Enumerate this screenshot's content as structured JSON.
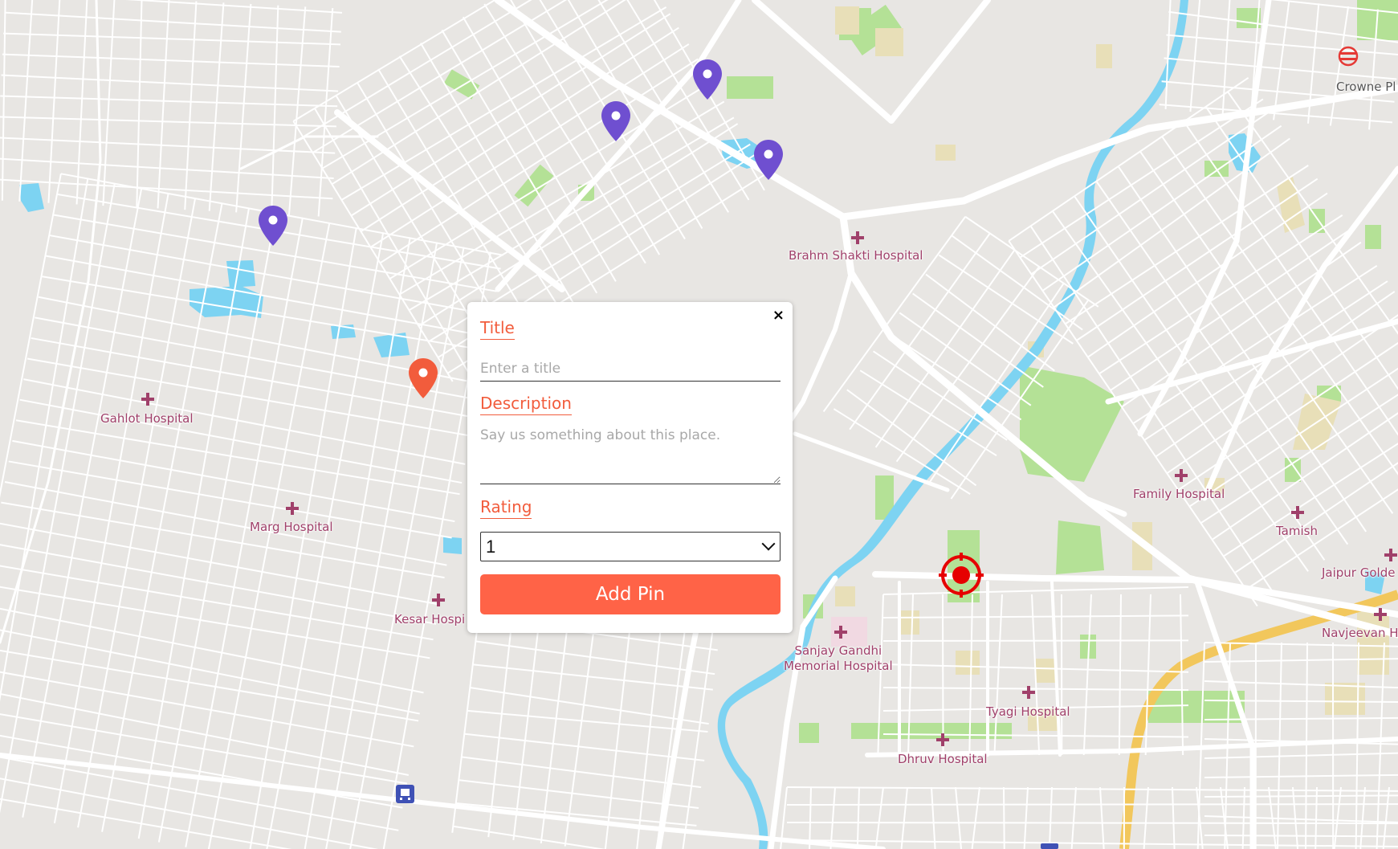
{
  "map": {
    "poi_labels": {
      "brahm_shakti": "Brahm Shakti Hospital",
      "gahlot": "Gahlot Hospital",
      "marg": "Marg Hospital",
      "kesar": "Kesar Hospi",
      "sanjay_gandhi_1": "Sanjay Gandhi",
      "sanjay_gandhi_2": "Memorial Hospital",
      "tyagi": "Tyagi Hospital",
      "dhruv": "Dhruv Hospital",
      "family": "Family Hospital",
      "tamish": "Tamish",
      "jaipur_golden": "Jaipur Golde",
      "navjeevan": "Navjeevan H",
      "crowne": "Crowne Pl"
    },
    "colors": {
      "land": "#e8e6e3",
      "road": "#ffffff",
      "park": "#b4e196",
      "water": "#7dd3f2",
      "highway": "#f2c75c",
      "hospital_area": "#f1d9e2",
      "sand": "#e8dfb8",
      "existing_pin": "#6f4fd0",
      "new_pin": "#f25c3c",
      "location_marker": "#e60000"
    }
  },
  "pins": {
    "existing_icon": "map-pin-icon",
    "new_icon": "map-pin-icon"
  },
  "popup": {
    "close_label": "×",
    "title_label": "Title",
    "title_placeholder": "Enter a title",
    "title_value": "",
    "description_label": "Description",
    "description_placeholder": "Say us something about this place.",
    "description_value": "",
    "rating_label": "Rating",
    "rating_selected": "1",
    "submit_label": "Add Pin",
    "accent_color": "#ff6347"
  }
}
